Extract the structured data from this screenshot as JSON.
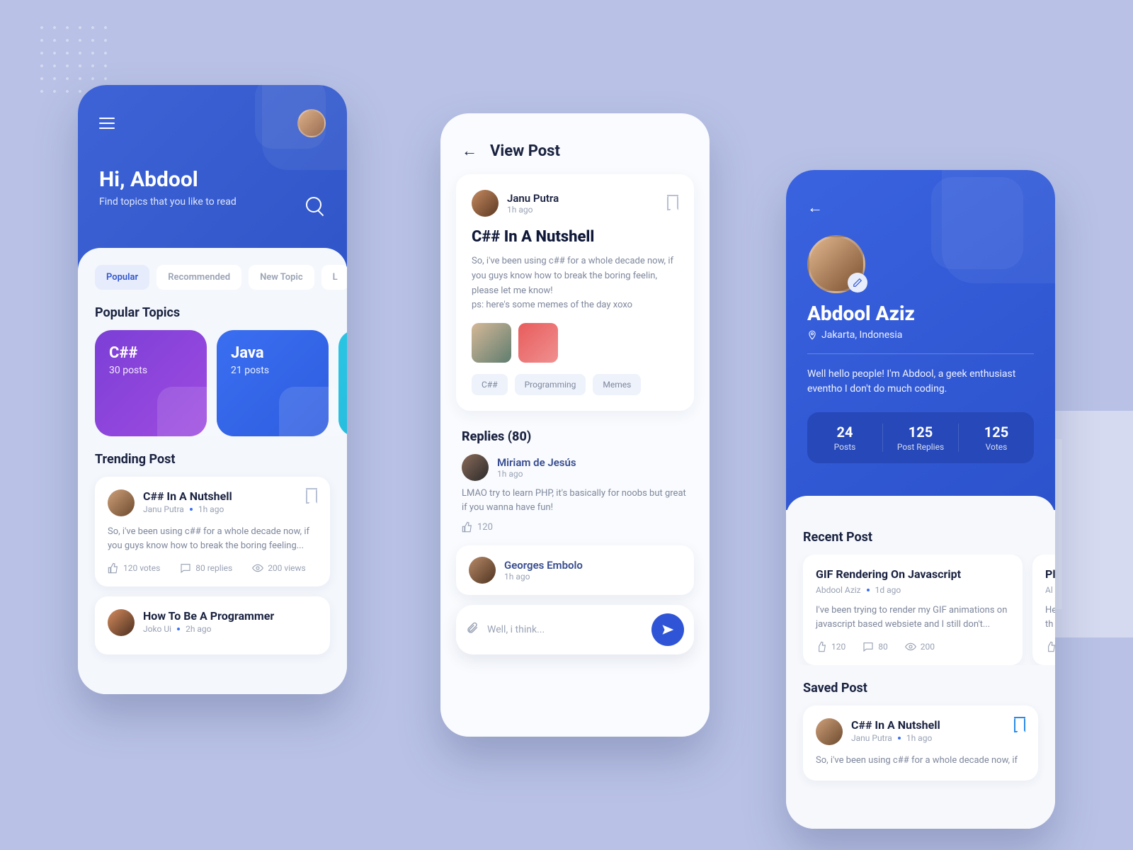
{
  "home": {
    "greeting": "Hi, Abdool",
    "subtitle": "Find topics that you like to read",
    "tabs": [
      "Popular",
      "Recommended",
      "New Topic",
      "L"
    ],
    "section_popular": "Popular Topics",
    "topics": [
      {
        "name": "C##",
        "posts": "30 posts"
      },
      {
        "name": "Java",
        "posts": "21 posts"
      }
    ],
    "section_trending": "Trending Post",
    "trending": {
      "title": "C## In A Nutshell",
      "author": "Janu Putra",
      "time": "1h ago",
      "excerpt": "So, i've been using c## for a whole decade now, if you guys know how to break the boring feeling...",
      "votes": "120 votes",
      "replies": "80 replies",
      "views": "200 views"
    },
    "second_post": {
      "title": "How To Be A Programmer",
      "author": "Joko Ui",
      "time": "2h ago"
    }
  },
  "view": {
    "header": "View Post",
    "author": "Janu Putra",
    "time": "1h ago",
    "title": "C## In A Nutshell",
    "body": "So, i've been using c## for a whole decade now, if you guys know how to break the boring feelin, please let me know!\nps: here's some memes of the day xoxo",
    "tags": [
      "C##",
      "Programming",
      "Memes"
    ],
    "replies_header": "Replies (80)",
    "reply1": {
      "name": "Miriam de Jesús",
      "time": "1h ago",
      "body": "LMAO try to learn PHP, it's basically for noobs but great if you wanna have fun!",
      "likes": "120"
    },
    "reply2": {
      "name": "Georges Embolo",
      "time": "1h ago"
    },
    "composer_placeholder": "Well, i think..."
  },
  "profile": {
    "name": "Abdool Aziz",
    "location": "Jakarta, Indonesia",
    "bio": "Well hello people! I'm Abdool, a geek enthusiast eventho I don't do much coding.",
    "stats": [
      {
        "num": "24",
        "label": "Posts"
      },
      {
        "num": "125",
        "label": "Post Replies"
      },
      {
        "num": "125",
        "label": "Votes"
      }
    ],
    "section_recent": "Recent Post",
    "recent": {
      "title": "GIF Rendering On Javascript",
      "author": "Abdool Aziz",
      "time": "1d ago",
      "excerpt": "I've been trying to render my GIF animations on javascript based websiete and I still don't...",
      "v": "120",
      "r": "80",
      "w": "200"
    },
    "recent_peek": {
      "title": "Pl",
      "author": "Al",
      "excerpt": "He\nth"
    },
    "section_saved": "Saved Post",
    "saved": {
      "title": "C## In A Nutshell",
      "author": "Janu Putra",
      "time": "1h ago",
      "excerpt": "So, i've been using c## for a whole decade now, if"
    }
  }
}
